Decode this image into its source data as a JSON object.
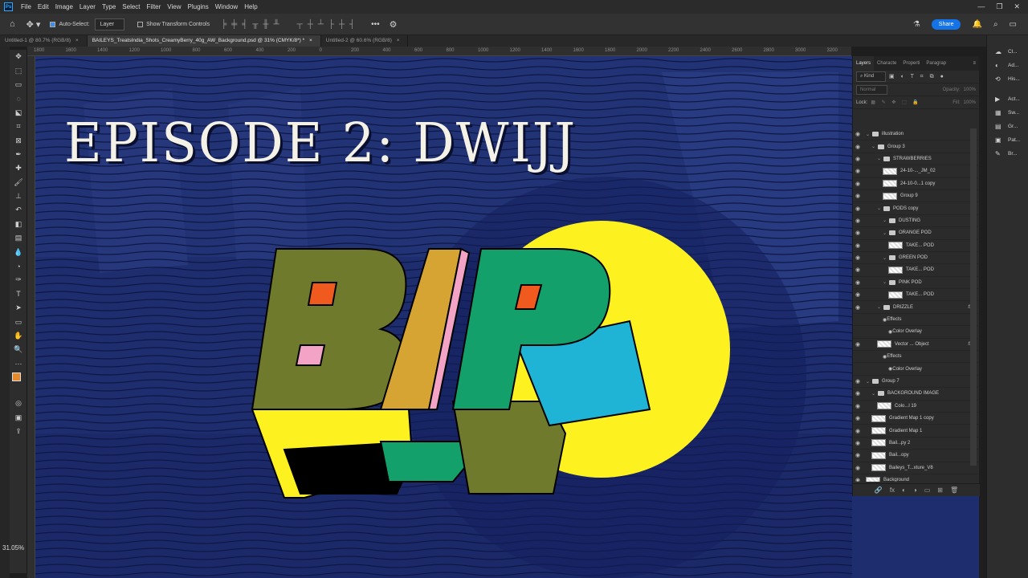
{
  "app": {
    "logo": "Ps"
  },
  "menu": [
    "File",
    "Edit",
    "Image",
    "Layer",
    "Type",
    "Select",
    "Filter",
    "View",
    "Plugins",
    "Window",
    "Help"
  ],
  "window_controls": [
    "—",
    "❐",
    "✕"
  ],
  "options_bar": {
    "auto_select_label": "Auto-Select:",
    "auto_select_value": "Layer",
    "transform_controls_label": "Show Transform Controls",
    "more": "•••",
    "share_label": "Share"
  },
  "tabs": [
    {
      "label": "Untitled-1 @ 80.7% (RGB/8)",
      "close": "×"
    },
    {
      "label": "BAILEYS_TreatsIndia_Shots_CreamyBerry_40g_AW_Background.psd @ 31% (CMYK/8*) *",
      "close": "×"
    },
    {
      "label": "Untitled-2 @ 60.6% (RGB/8)",
      "close": "×"
    }
  ],
  "ruler_labels": [
    "1800",
    "1600",
    "1400",
    "1200",
    "1000",
    "800",
    "600",
    "400",
    "200",
    "0",
    "200",
    "400",
    "600",
    "800",
    "1000",
    "1200",
    "1400",
    "1600",
    "1800",
    "2000",
    "2200",
    "2400",
    "2600",
    "2800",
    "3000",
    "3200"
  ],
  "canvas": {
    "title": "EPISODE 2: DWIJJ",
    "colors": {
      "bg": "#1d2d6e",
      "yellow": "#fdf21f",
      "olive": "#6f7a2c",
      "mustard": "#d6a432",
      "green": "#14a06a",
      "cyan": "#1fb4d6",
      "orange": "#f05a1e",
      "pink": "#f3a3c6"
    }
  },
  "zoom": "31.05%",
  "colors": {
    "foreground": "#e8892b",
    "background": "#6b1e1e"
  },
  "layers_panel": {
    "tabs": [
      "Layers",
      "Characte",
      "Properti",
      "Paragrap"
    ],
    "kind_label": "Kind",
    "blend_mode": "Normal",
    "opacity_label": "Opacity:",
    "opacity_value": "100%",
    "lock_label": "Lock:",
    "fill_label": "Fill:",
    "fill_value": "100%",
    "layers": [
      {
        "name": "illustration",
        "type": "folder",
        "indent": 0
      },
      {
        "name": "Group 3",
        "type": "folder",
        "indent": 1
      },
      {
        "name": "STRAWBERRIES",
        "type": "folder",
        "indent": 2
      },
      {
        "name": "24-10-..._JM_02",
        "type": "layer",
        "indent": 3
      },
      {
        "name": "24-10-0...1 copy",
        "type": "layer",
        "indent": 3
      },
      {
        "name": "Group 9",
        "type": "layer",
        "indent": 3
      },
      {
        "name": "PODS copy",
        "type": "folder",
        "indent": 2
      },
      {
        "name": "DUSTING",
        "type": "folder",
        "indent": 3
      },
      {
        "name": "ORANGE POD",
        "type": "folder",
        "indent": 3
      },
      {
        "name": "TAKE... POD",
        "type": "layer",
        "indent": 4
      },
      {
        "name": "GREEN POD",
        "type": "folder",
        "indent": 3
      },
      {
        "name": "TAKE... POD",
        "type": "layer",
        "indent": 4
      },
      {
        "name": "PINK POD",
        "type": "folder",
        "indent": 3
      },
      {
        "name": "TAKE... POD",
        "type": "layer",
        "indent": 4
      },
      {
        "name": "DRIZZLE",
        "type": "folder",
        "indent": 2,
        "fx": "fx"
      },
      {
        "name": "Effects",
        "type": "effect",
        "indent": 3
      },
      {
        "name": "Color Overlay",
        "type": "effect",
        "indent": 4
      },
      {
        "name": "Vector ... Object",
        "type": "layer",
        "indent": 2,
        "fx": "fx"
      },
      {
        "name": "Effects",
        "type": "effect",
        "indent": 3
      },
      {
        "name": "Color Overlay",
        "type": "effect",
        "indent": 4
      },
      {
        "name": "Group 7",
        "type": "folder",
        "indent": 0
      },
      {
        "name": "BACKGROUND IMAGE",
        "type": "folder",
        "indent": 1
      },
      {
        "name": "Colo...l 19",
        "type": "layer",
        "indent": 2
      },
      {
        "name": "Gradient Map 1 copy",
        "type": "layer",
        "indent": 1
      },
      {
        "name": "Gradient Map 1",
        "type": "layer",
        "indent": 1
      },
      {
        "name": "Bail...py 2",
        "type": "layer",
        "indent": 1
      },
      {
        "name": "Bail...opy",
        "type": "layer",
        "indent": 1
      },
      {
        "name": "Baileys_T...xture_V8",
        "type": "layer",
        "indent": 1
      },
      {
        "name": "Background",
        "type": "layer",
        "indent": 0
      }
    ],
    "footer_icons": [
      "🔗",
      "fx",
      "◐",
      "◑",
      "▭",
      "⊞",
      "🗑"
    ]
  },
  "dock": [
    {
      "icon": "☁",
      "label": "Cl..."
    },
    {
      "icon": "◐",
      "label": "Ad..."
    },
    {
      "icon": "⟲",
      "label": "His..."
    },
    {
      "icon": "▶",
      "label": "Act..."
    },
    {
      "icon": "▦",
      "label": "Sw..."
    },
    {
      "icon": "▤",
      "label": "Gr..."
    },
    {
      "icon": "▣",
      "label": "Pat..."
    },
    {
      "icon": "✎",
      "label": "Br..."
    }
  ]
}
